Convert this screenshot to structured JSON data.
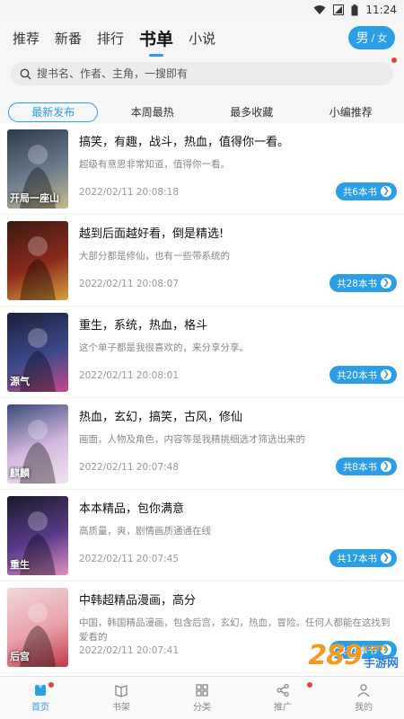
{
  "status_bar": {
    "time": "11:24"
  },
  "top_tabs": [
    {
      "label": "推荐",
      "active": false
    },
    {
      "label": "新番",
      "active": false
    },
    {
      "label": "排行",
      "active": false
    },
    {
      "label": "书单",
      "active": true
    },
    {
      "label": "小说",
      "active": false
    }
  ],
  "gender": {
    "main": "男",
    "sep": "/",
    "alt": "女"
  },
  "search": {
    "placeholder": "搜书名、作者、主角，一搜即有"
  },
  "sub_tabs": [
    {
      "label": "最新发布",
      "active": true
    },
    {
      "label": "本周最热",
      "active": false
    },
    {
      "label": "最多收藏",
      "active": false
    },
    {
      "label": "小编推荐",
      "active": false
    }
  ],
  "booklists": [
    {
      "title": "搞笑，有趣，战斗，热血，值得你一看。",
      "desc": "超级有意思非常知道，值得你一看。",
      "time": "2022/02/11 20:08:18",
      "count": "共6本书",
      "cover_text": "开局一座山",
      "cover_colors": [
        "#2d3a4a",
        "#6b7c8f",
        "#c9b98a"
      ]
    },
    {
      "title": "越到后面越好看，倒是精选!",
      "desc": "大部分都是修仙，也有一些带系统的",
      "time": "2022/02/11 20:08:07",
      "count": "共28本书",
      "cover_text": "",
      "cover_colors": [
        "#3a1a12",
        "#8a2a1a",
        "#d8a040"
      ]
    },
    {
      "title": "重生，系统，热血，格斗",
      "desc": "这个单子都是我很喜欢的，来分享分享。",
      "time": "2022/02/11 20:08:01",
      "count": "共20本书",
      "cover_text": "源气",
      "cover_colors": [
        "#1b1f3a",
        "#3c4a8a",
        "#c64a8a"
      ]
    },
    {
      "title": "热血，玄幻，搞笑，古风，修仙",
      "desc": "画面，人物及角色，内容等是我精挑细选才筛选出来的",
      "time": "2022/02/11 20:07:48",
      "count": "共8本书",
      "cover_text": "麒麟",
      "cover_colors": [
        "#3a4a7a",
        "#d6b9e0",
        "#f0e0f0"
      ]
    },
    {
      "title": "本本精品，包你满意",
      "desc": "高质量，爽，剧情画质通通在线",
      "time": "2022/02/11 20:07:45",
      "count": "共17本书",
      "cover_text": "重生",
      "cover_colors": [
        "#1a1a2a",
        "#5a3a8a",
        "#e090c0"
      ]
    },
    {
      "title": "中韩超精品漫画，高分",
      "desc": "中国，韩国精品漫画，包含后宫，玄幻，热血，冒险。任何人都能在这找到爱看的",
      "time": "2022/02/11 20:07:41",
      "count": "共21本书",
      "cover_text": "后宫",
      "cover_colors": [
        "#f0d8dc",
        "#e8a0a8",
        "#c03a4a"
      ]
    }
  ],
  "watermark": {
    "number": "289",
    "suffix": "com",
    "text": "手游网"
  },
  "bottom_nav": [
    {
      "label": "首页",
      "active": true,
      "dot": true,
      "icon": "home-icon"
    },
    {
      "label": "书架",
      "active": false,
      "dot": false,
      "icon": "bookshelf-icon"
    },
    {
      "label": "分类",
      "active": false,
      "dot": false,
      "icon": "category-icon"
    },
    {
      "label": "推广",
      "active": false,
      "dot": true,
      "icon": "share-icon"
    },
    {
      "label": "我的",
      "active": false,
      "dot": false,
      "icon": "profile-icon"
    }
  ],
  "colors": {
    "accent": "#2b9ee8",
    "badge_dot": "#e8403a"
  }
}
